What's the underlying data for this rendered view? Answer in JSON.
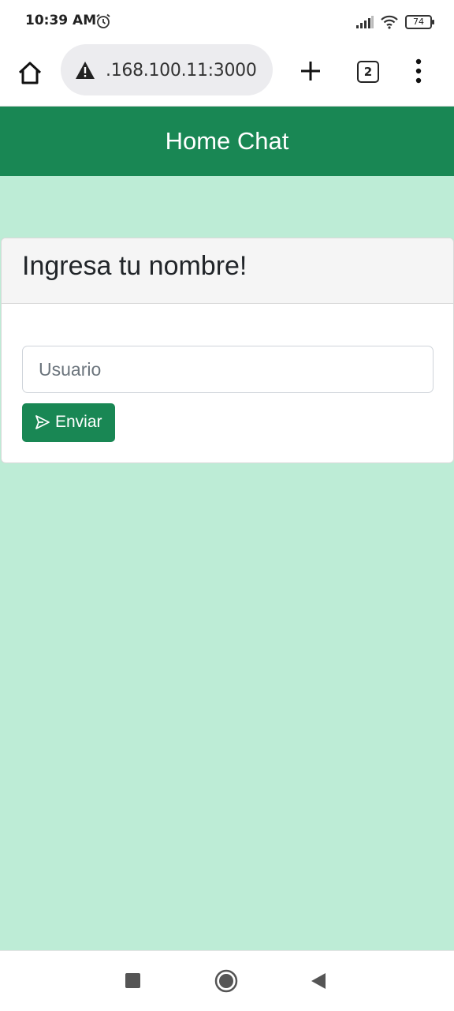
{
  "status_bar": {
    "time": "10:39 AM",
    "battery": "74"
  },
  "browser": {
    "url": ".168.100.11:3000",
    "tab_count": "2"
  },
  "app": {
    "title": "Home Chat"
  },
  "card": {
    "title": "Ingresa tu nombre!",
    "input_placeholder": "Usuario",
    "button_label": "Enviar"
  },
  "colors": {
    "primary": "#198754",
    "background": "#bdecd6"
  },
  "icons": [
    "alarm-icon",
    "signal-icon",
    "wifi-icon",
    "battery-icon",
    "home-icon",
    "warning-icon",
    "plus-icon",
    "tabs-icon",
    "more-vert-icon",
    "send-icon",
    "nav-recents-icon",
    "nav-home-icon",
    "nav-back-icon"
  ]
}
